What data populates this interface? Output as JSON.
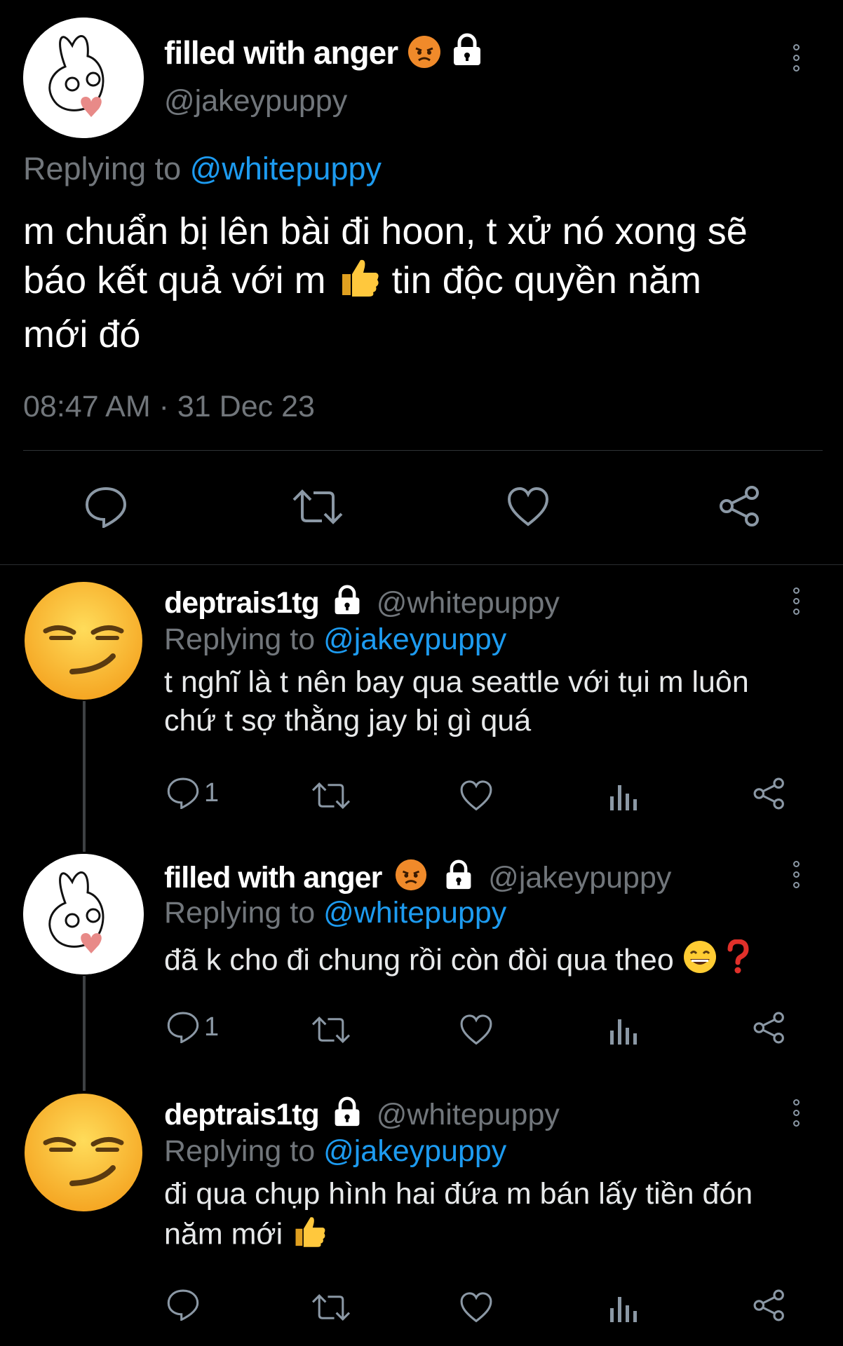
{
  "main_tweet": {
    "display_name": "filled with anger",
    "handle": "@jakeypuppy",
    "replying_prefix": "Replying to",
    "replying_to": "@whitepuppy",
    "text_line1": "m chuẩn bị lên bài đi hoon, t xử nó xong sẽ",
    "text_line2a": "báo kết quả với m",
    "text_line2b": "tin độc quyền năm",
    "text_line3": "mới đó",
    "timestamp": "08:47 AM · 31 Dec 23"
  },
  "replies": [
    {
      "display_name": "deptrais1tg",
      "handle": "@whitepuppy",
      "replying_prefix": "Replying to",
      "replying_to": "@jakeypuppy",
      "line1": "t nghĩ là t nên bay qua seattle với tụi m luôn",
      "line2": "chứ t sợ thằng jay bị gì quá",
      "reply_count": "1"
    },
    {
      "display_name": "filled with anger",
      "handle": "@jakeypuppy",
      "replying_prefix": "Replying to",
      "replying_to": "@whitepuppy",
      "line1": "đã k cho đi chung rồi còn đòi qua theo",
      "reply_count": "1"
    },
    {
      "display_name": "deptrais1tg",
      "handle": "@whitepuppy",
      "replying_prefix": "Replying to",
      "replying_to": "@jakeypuppy",
      "line1": "đi qua chụp hình hai đứa m bán lấy tiền đón",
      "line2": "năm mới"
    }
  ],
  "icons": {
    "angry": "angry-face-emoji",
    "lock": "lock-icon",
    "thumbs_up": "thumbs-up-emoji",
    "grin": "grinning-face-emoji",
    "question": "red-question-mark-emoji",
    "smirk": "smirking-face-emoji"
  },
  "colors": {
    "background": "#000000",
    "link": "#1d9bf0",
    "muted": "#71767b",
    "icon": "#8b98a5"
  }
}
